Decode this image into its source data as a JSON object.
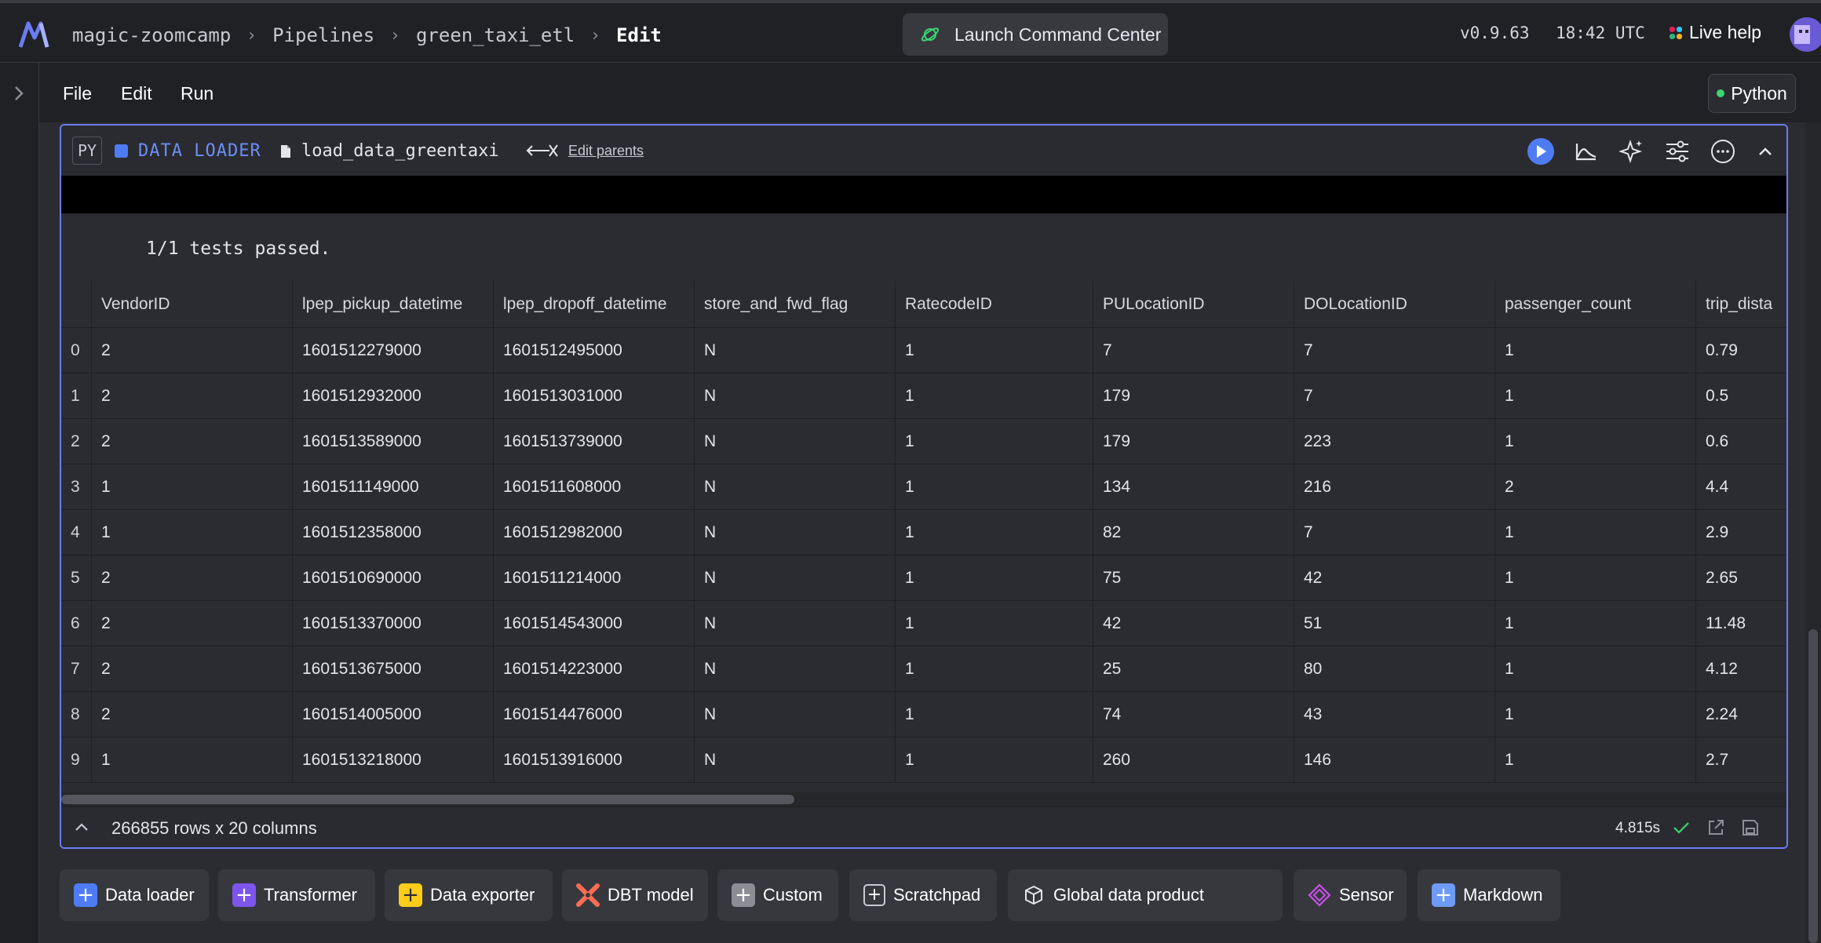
{
  "breadcrumb": {
    "project": "magic-zoomcamp",
    "section": "Pipelines",
    "pipeline": "green_taxi_etl",
    "current": "Edit"
  },
  "header": {
    "command_center": "Launch Command Center",
    "version": "v0.9.63",
    "time": "18:42 UTC",
    "live_help": "Live help"
  },
  "menu": {
    "file": "File",
    "edit": "Edit",
    "run": "Run"
  },
  "kernel": {
    "label": "Python",
    "status_color": "#3bd671"
  },
  "block": {
    "language_tag": "PY",
    "type_label": "DATA LOADER",
    "type_color": "#4f7cf5",
    "file_name": "load_data_greentaxi",
    "edit_parents": "Edit parents",
    "test_output": "1/1 tests passed.",
    "columns": [
      "VendorID",
      "lpep_pickup_datetime",
      "lpep_dropoff_datetime",
      "store_and_fwd_flag",
      "RatecodeID",
      "PULocationID",
      "DOLocationID",
      "passenger_count",
      "trip_dista"
    ],
    "rows": [
      {
        "index": "0",
        "cells": [
          "2",
          "1601512279000",
          "1601512495000",
          "N",
          "1",
          "7",
          "7",
          "1",
          "0.79"
        ]
      },
      {
        "index": "1",
        "cells": [
          "2",
          "1601512932000",
          "1601513031000",
          "N",
          "1",
          "179",
          "7",
          "1",
          "0.5"
        ]
      },
      {
        "index": "2",
        "cells": [
          "2",
          "1601513589000",
          "1601513739000",
          "N",
          "1",
          "179",
          "223",
          "1",
          "0.6"
        ]
      },
      {
        "index": "3",
        "cells": [
          "1",
          "1601511149000",
          "1601511608000",
          "N",
          "1",
          "134",
          "216",
          "2",
          "4.4"
        ]
      },
      {
        "index": "4",
        "cells": [
          "1",
          "1601512358000",
          "1601512982000",
          "N",
          "1",
          "82",
          "7",
          "1",
          "2.9"
        ]
      },
      {
        "index": "5",
        "cells": [
          "2",
          "1601510690000",
          "1601511214000",
          "N",
          "1",
          "75",
          "42",
          "1",
          "2.65"
        ]
      },
      {
        "index": "6",
        "cells": [
          "2",
          "1601513370000",
          "1601514543000",
          "N",
          "1",
          "42",
          "51",
          "1",
          "11.48"
        ]
      },
      {
        "index": "7",
        "cells": [
          "2",
          "1601513675000",
          "1601514223000",
          "N",
          "1",
          "25",
          "80",
          "1",
          "4.12"
        ]
      },
      {
        "index": "8",
        "cells": [
          "2",
          "1601514005000",
          "1601514476000",
          "N",
          "1",
          "74",
          "43",
          "1",
          "2.24"
        ]
      },
      {
        "index": "9",
        "cells": [
          "1",
          "1601513218000",
          "1601513916000",
          "N",
          "1",
          "260",
          "146",
          "1",
          "2.7"
        ]
      }
    ],
    "rows_info": "266855 rows x 20 columns",
    "execution_time": "4.815s"
  },
  "add_blocks": [
    {
      "label": "Data loader",
      "icon": "plus-icon",
      "color": "#4f7cf5"
    },
    {
      "label": "Transformer",
      "icon": "plus-icon",
      "color": "#7d55ec"
    },
    {
      "label": "Data exporter",
      "icon": "plus-icon",
      "color": "#ffcc19"
    },
    {
      "label": "DBT model",
      "icon": "dbt-icon",
      "color": "#fc6c53"
    },
    {
      "label": "Custom",
      "icon": "plus-icon",
      "color": "#8c8d94"
    },
    {
      "label": "Scratchpad",
      "icon": "plus-icon",
      "color": "#37383e"
    },
    {
      "label": "Global data product",
      "icon": "cube-icon",
      "color": "#37383e"
    },
    {
      "label": "Sensor",
      "icon": "sensor-icon",
      "color": "#c950e8"
    },
    {
      "label": "Markdown",
      "icon": "plus-icon",
      "color": "#6e9bf5"
    }
  ]
}
